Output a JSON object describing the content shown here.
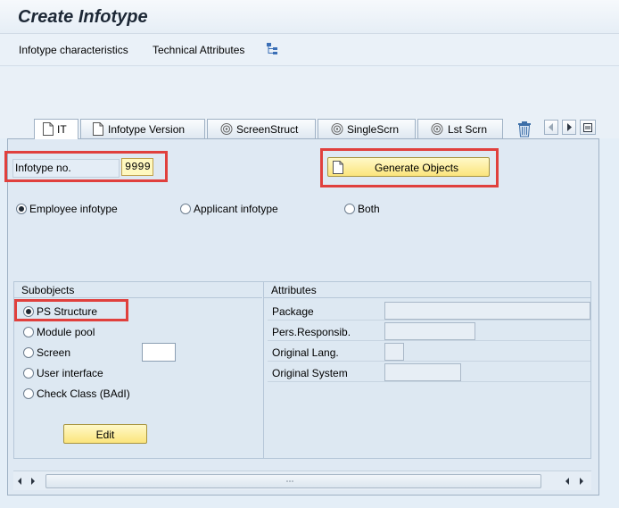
{
  "window": {
    "title": "Create Infotype"
  },
  "menu": {
    "items": [
      "Infotype characteristics",
      "Technical Attributes"
    ],
    "icon": "hierarchy-icon"
  },
  "tabs": [
    {
      "label": "IT",
      "icon": "document-icon",
      "active": true
    },
    {
      "label": "Infotype Version",
      "icon": "document-icon",
      "active": false
    },
    {
      "label": "ScreenStruct",
      "icon": "spiral-icon",
      "active": false
    },
    {
      "label": "SingleScrn",
      "icon": "spiral-icon",
      "active": false
    },
    {
      "label": "Lst Scrn",
      "icon": "spiral-icon",
      "active": false
    }
  ],
  "tab_controls": [
    "trash-icon",
    "scroll-left-icon",
    "scroll-right-icon",
    "tab-list-icon"
  ],
  "infotype": {
    "label": "Infotype no.",
    "value": "9999"
  },
  "generate_button": {
    "label": "Generate Objects",
    "icon": "document-icon"
  },
  "infotype_kind": {
    "options": [
      "Employee infotype",
      "Applicant infotype",
      "Both"
    ],
    "selected": "Employee infotype"
  },
  "subobjects": {
    "title": "Subobjects",
    "options": [
      "PS Structure",
      "Module pool",
      "Screen",
      "User interface",
      "Check Class (BAdI)"
    ],
    "selected": "PS Structure",
    "screen_value": "",
    "edit_label": "Edit"
  },
  "attributes": {
    "title": "Attributes",
    "rows": [
      {
        "label": "Package",
        "value": ""
      },
      {
        "label": "Pers.Responsib.",
        "value": ""
      },
      {
        "label": "Original Lang.",
        "value": ""
      },
      {
        "label": "Original System",
        "value": ""
      }
    ]
  },
  "colors": {
    "highlight": "#e0403d",
    "button": "#fbe57c",
    "background": "#dfe9f3"
  }
}
